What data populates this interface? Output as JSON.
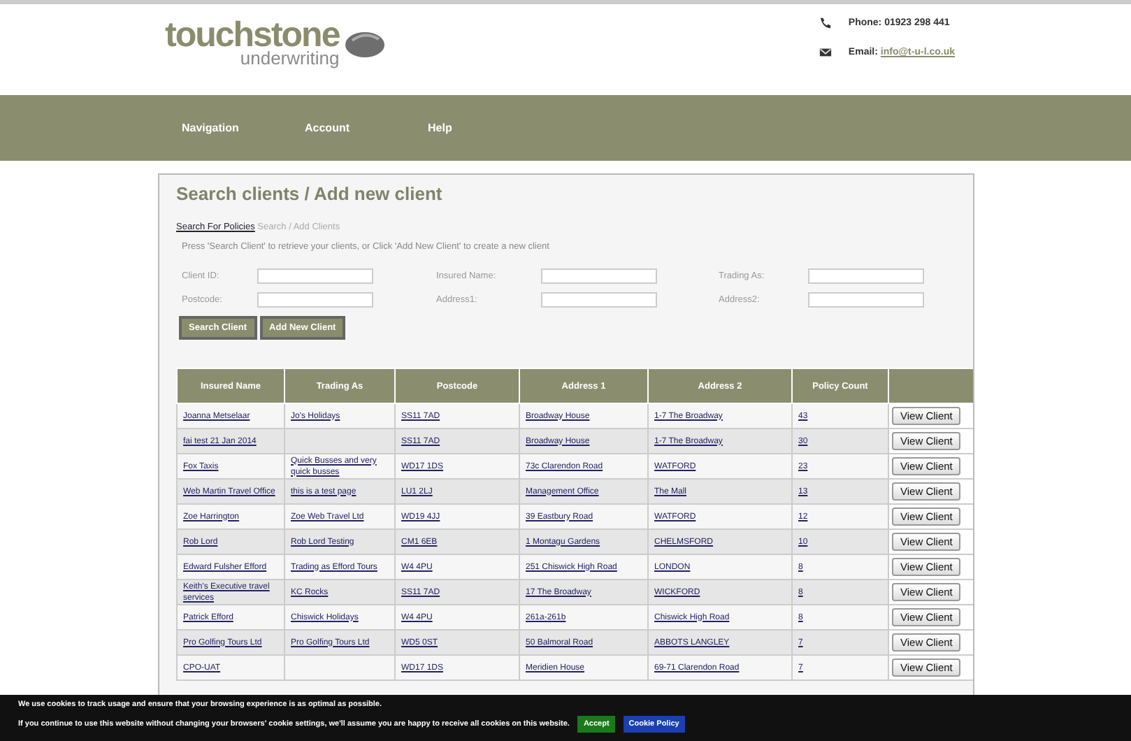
{
  "header": {
    "logo_title": "touchstone",
    "logo_subtitle": "underwriting",
    "phone": "Phone: 01923 298 441",
    "email_label": "Email:",
    "email": "info@t-u-l.co.uk"
  },
  "nav": [
    "Navigation",
    "Account",
    "Help"
  ],
  "page": {
    "title": "Search clients / Add new client",
    "breadcrumb": [
      {
        "label": "Search For Policies",
        "link": true
      },
      {
        "label": "Search / Add Clients",
        "link": false
      }
    ],
    "instructions": "Press 'Search Client' to retrieve your clients, or Click 'Add New Client' to create a new client",
    "fields": [
      {
        "label": "Client ID:"
      },
      {
        "label": "Insured Name:"
      },
      {
        "label": "Trading As:"
      },
      {
        "label": "Postcode:"
      },
      {
        "label": "Address1:"
      },
      {
        "label": "Address2:"
      }
    ],
    "buttons": [
      "Search Client",
      "Add New Client"
    ]
  },
  "table": {
    "columns": [
      "Insured Name",
      "Trading As",
      "Postcode",
      "Address 1",
      "Address 2",
      "Policy Count"
    ],
    "rows": [
      {
        "insured_name": "Joanna Metselaar",
        "trading_as": "Jo's Holidays",
        "postcode": "SS11 7AD",
        "address_1": "Broadway House",
        "address_2": "1-7 The Broadway",
        "policy_count": "43",
        "action": "View Client"
      },
      {
        "insured_name": "fai test 21 Jan 2014",
        "postcode": "SS11 7AD",
        "address_1": "Broadway House",
        "address_2": "1-7 The Broadway",
        "policy_count": "30",
        "action": "View Client"
      },
      {
        "insured_name": "Fox Taxis",
        "trading_as": "Quick Busses and very quick busses",
        "postcode": "WD17 1DS",
        "address_1": "73c Clarendon Road",
        "address_2": "WATFORD",
        "policy_count": "23",
        "action": "View Client"
      },
      {
        "insured_name": "Web Martin Travel Office",
        "trading_as": "this is a test page",
        "postcode": "LU1 2LJ",
        "address_1": "Management Office",
        "address_2": "The Mall",
        "policy_count": "13",
        "action": "View Client"
      },
      {
        "insured_name": "Zoe Harrington",
        "trading_as": "Zoe Web Travel Ltd",
        "postcode": "WD19 4JJ",
        "address_1": "39 Eastbury Road",
        "address_2": "WATFORD",
        "policy_count": "12",
        "action": "View Client"
      },
      {
        "insured_name": "Rob Lord",
        "trading_as": "Rob Lord Testing",
        "postcode": "CM1 6EB",
        "address_1": "1 Montagu Gardens",
        "address_2": "CHELMSFORD",
        "policy_count": "10",
        "action": "View Client"
      },
      {
        "insured_name": "Edward Fulsher Efford",
        "trading_as": "Trading as Efford Tours",
        "postcode": "W4 4PU",
        "address_1": "251 Chiswick High Road",
        "address_2": "LONDON",
        "policy_count": "8",
        "action": "View Client"
      },
      {
        "insured_name": "Keith's Executive travel services",
        "trading_as": "KC Rocks",
        "postcode": "SS11 7AD",
        "address_1": "17 The Broadway",
        "address_2": "WICKFORD",
        "policy_count": "8",
        "action": "View Client"
      },
      {
        "insured_name": "Patrick Efford",
        "trading_as": "Chiswick Holidays",
        "postcode": "W4 4PU",
        "address_1": "261a-261b",
        "address_2": "Chiswick High Road",
        "policy_count": "8",
        "action": "View Client"
      },
      {
        "insured_name": "Pro Golfing Tours Ltd",
        "trading_as": "Pro Golfing Tours Ltd",
        "postcode": "WD5 0ST",
        "address_1": "50 Balmoral Road",
        "address_2": "ABBOTS LANGLEY",
        "policy_count": "7",
        "action": "View Client"
      },
      {
        "insured_name": "CPO-UAT",
        "postcode": "WD17 1DS",
        "address_1": "Meridien House",
        "address_2": "69-71 Clarendon Road",
        "policy_count": "7",
        "action": "View Client"
      }
    ]
  },
  "cookie_banner": {
    "lines": [
      "We use cookies to track usage and ensure that your browsing experience is as optimal as possible.",
      "If you continue to use this website without changing your browsers' cookie settings, we'll assume you are happy to receive all cookies on this website."
    ],
    "buttons": [
      {
        "label": "Accept",
        "kind": "accept"
      },
      {
        "label": "Cookie Policy",
        "kind": "policy"
      }
    ]
  }
}
